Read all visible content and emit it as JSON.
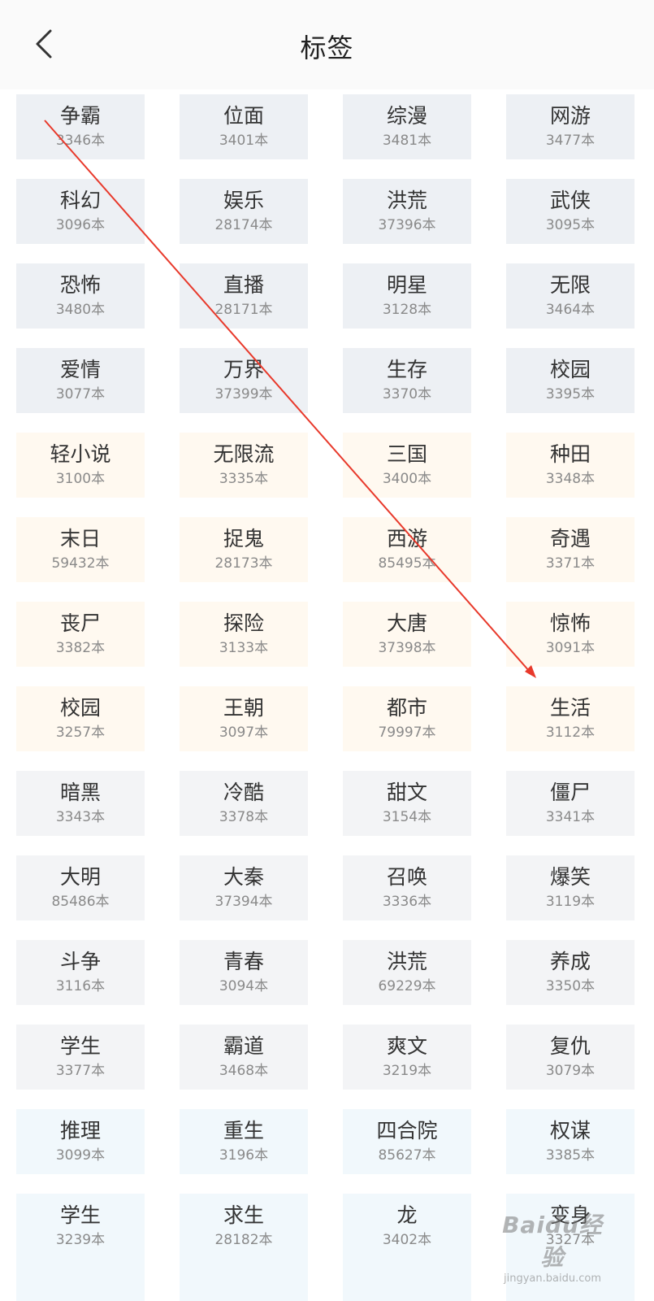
{
  "header": {
    "title": "标签",
    "back_icon": "chevron-left-icon"
  },
  "colors": {
    "gray_tag": "#edf0f4",
    "cream_tag": "#fff9f0",
    "light_tag": "#f3f4f6",
    "blue_tag": "#f1f8fc",
    "annotation_arrow": "#e8392b"
  },
  "tags": [
    {
      "name": "争霸",
      "count": "3346本"
    },
    {
      "name": "位面",
      "count": "3401本"
    },
    {
      "name": "综漫",
      "count": "3481本"
    },
    {
      "name": "网游",
      "count": "3477本"
    },
    {
      "name": "科幻",
      "count": "3096本"
    },
    {
      "name": "娱乐",
      "count": "28174本"
    },
    {
      "name": "洪荒",
      "count": "37396本"
    },
    {
      "name": "武侠",
      "count": "3095本"
    },
    {
      "name": "恐怖",
      "count": "3480本"
    },
    {
      "name": "直播",
      "count": "28171本"
    },
    {
      "name": "明星",
      "count": "3128本"
    },
    {
      "name": "无限",
      "count": "3464本"
    },
    {
      "name": "爱情",
      "count": "3077本"
    },
    {
      "name": "万界",
      "count": "37399本"
    },
    {
      "name": "生存",
      "count": "3370本"
    },
    {
      "name": "校园",
      "count": "3395本"
    },
    {
      "name": "轻小说",
      "count": "3100本"
    },
    {
      "name": "无限流",
      "count": "3335本"
    },
    {
      "name": "三国",
      "count": "3400本"
    },
    {
      "name": "种田",
      "count": "3348本"
    },
    {
      "name": "末日",
      "count": "59432本"
    },
    {
      "name": "捉鬼",
      "count": "28173本"
    },
    {
      "name": "西游",
      "count": "85495本"
    },
    {
      "name": "奇遇",
      "count": "3371本"
    },
    {
      "name": "丧尸",
      "count": "3382本"
    },
    {
      "name": "探险",
      "count": "3133本"
    },
    {
      "name": "大唐",
      "count": "37398本"
    },
    {
      "name": "惊怖",
      "count": "3091本"
    },
    {
      "name": "校园",
      "count": "3257本"
    },
    {
      "name": "王朝",
      "count": "3097本"
    },
    {
      "name": "都市",
      "count": "79997本"
    },
    {
      "name": "生活",
      "count": "3112本"
    },
    {
      "name": "暗黑",
      "count": "3343本"
    },
    {
      "name": "冷酷",
      "count": "3378本"
    },
    {
      "name": "甜文",
      "count": "3154本"
    },
    {
      "name": "僵尸",
      "count": "3341本"
    },
    {
      "name": "大明",
      "count": "85486本"
    },
    {
      "name": "大秦",
      "count": "37394本"
    },
    {
      "name": "召唤",
      "count": "3336本"
    },
    {
      "name": "爆笑",
      "count": "3119本"
    },
    {
      "name": "斗争",
      "count": "3116本"
    },
    {
      "name": "青春",
      "count": "3094本"
    },
    {
      "name": "洪荒",
      "count": "69229本"
    },
    {
      "name": "养成",
      "count": "3350本"
    },
    {
      "name": "学生",
      "count": "3377本"
    },
    {
      "name": "霸道",
      "count": "3468本"
    },
    {
      "name": "爽文",
      "count": "3219本"
    },
    {
      "name": "复仇",
      "count": "3079本"
    },
    {
      "name": "推理",
      "count": "3099本"
    },
    {
      "name": "重生",
      "count": "3196本"
    },
    {
      "name": "四合院",
      "count": "85627本"
    },
    {
      "name": "权谋",
      "count": "3385本"
    },
    {
      "name": "学生",
      "count": "3239本"
    },
    {
      "name": "求生",
      "count": "28182本"
    },
    {
      "name": "龙",
      "count": "3402本"
    },
    {
      "name": "变身",
      "count": "3327本"
    }
  ],
  "watermark": {
    "logo": "Baidu经验",
    "url": "jingyan.baidu.com"
  }
}
